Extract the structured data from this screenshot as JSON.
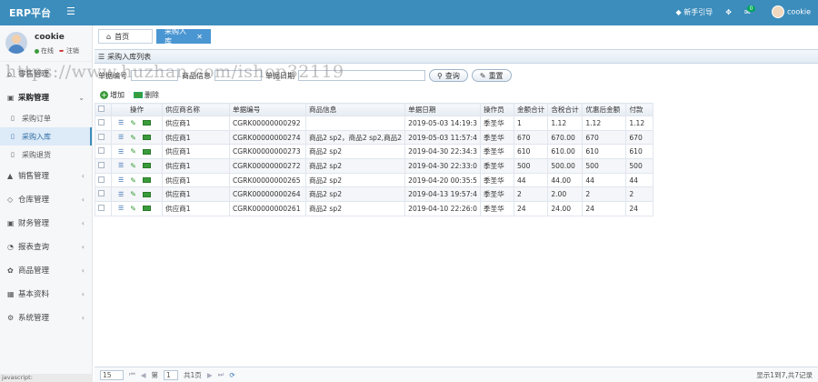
{
  "header": {
    "brand": "ERP平台",
    "menu_icon": "hamburger-icon",
    "guide_label": "新手引导",
    "notif_count": "0",
    "user_name": "cookie"
  },
  "sidebar": {
    "user_name": "cookie",
    "status_online": "在线",
    "logout": "注销",
    "items": [
      {
        "label": "零售管理",
        "icon": "home-icon"
      },
      {
        "label": "采购管理",
        "icon": "cart-icon",
        "open": true
      },
      {
        "label": "采购订单",
        "icon": "doc-icon"
      },
      {
        "label": "采购入库",
        "icon": "doc-icon",
        "active": true
      },
      {
        "label": "采购退货",
        "icon": "doc-icon"
      },
      {
        "label": "销售管理",
        "icon": "sales-icon"
      },
      {
        "label": "仓库管理",
        "icon": "box-icon"
      },
      {
        "label": "财务管理",
        "icon": "money-icon"
      },
      {
        "label": "报表查询",
        "icon": "report-icon"
      },
      {
        "label": "商品管理",
        "icon": "goods-icon"
      },
      {
        "label": "基本资料",
        "icon": "grid-icon"
      },
      {
        "label": "系统管理",
        "icon": "gear-icon"
      }
    ]
  },
  "tabs": [
    {
      "label": "首页"
    },
    {
      "label": "采购入库"
    }
  ],
  "panel": {
    "title": "采购入库列表"
  },
  "search": {
    "f1_label": "单据编号",
    "f2_label": "商品信息",
    "f3_label": "单据日期",
    "query_btn": "查询",
    "reset_btn": "重置"
  },
  "toolbar": {
    "add": "增加",
    "delete": "删除"
  },
  "table": {
    "columns": [
      "",
      "操作",
      "供应商名称",
      "单据编号",
      "商品信息",
      "单据日期",
      "操作员",
      "金额合计",
      "含税合计",
      "优惠后金额",
      "付款"
    ],
    "rows": [
      [
        "供应商1",
        "CGRK00000000292",
        "",
        "2019-05-03 14:19:3",
        "季圣华",
        "1",
        "1.12",
        "1.12",
        "1.12"
      ],
      [
        "供应商1",
        "CGRK00000000274",
        "商品2 sp2，商品2 sp2,商品2",
        "2019-05-03 11:57:4",
        "季圣华",
        "670",
        "670.00",
        "670",
        "670"
      ],
      [
        "供应商1",
        "CGRK00000000273",
        "商品2 sp2",
        "2019-04-30 22:34:3",
        "季圣华",
        "610",
        "610.00",
        "610",
        "610"
      ],
      [
        "供应商1",
        "CGRK00000000272",
        "商品2 sp2",
        "2019-04-30 22:33:0",
        "季圣华",
        "500",
        "500.00",
        "500",
        "500"
      ],
      [
        "供应商1",
        "CGRK00000000265",
        "商品2 sp2",
        "2019-04-20 00:35:5",
        "季圣华",
        "44",
        "44.00",
        "44",
        "44"
      ],
      [
        "供应商1",
        "CGRK00000000264",
        "商品2 sp2",
        "2019-04-13 19:57:4",
        "季圣华",
        "2",
        "2.00",
        "2",
        "2"
      ],
      [
        "供应商1",
        "CGRK00000000261",
        "商品2 sp2",
        "2019-04-10 22:26:0",
        "季圣华",
        "24",
        "24.00",
        "24",
        "24"
      ]
    ]
  },
  "pager": {
    "page_size": "15",
    "page_label_pre": "第",
    "page_num": "1",
    "page_label_post": "共1页",
    "info": "显示1到7,共7记录"
  },
  "statusbar": "javascript:",
  "watermark": "https://www.huzhan.com/ishop32119"
}
